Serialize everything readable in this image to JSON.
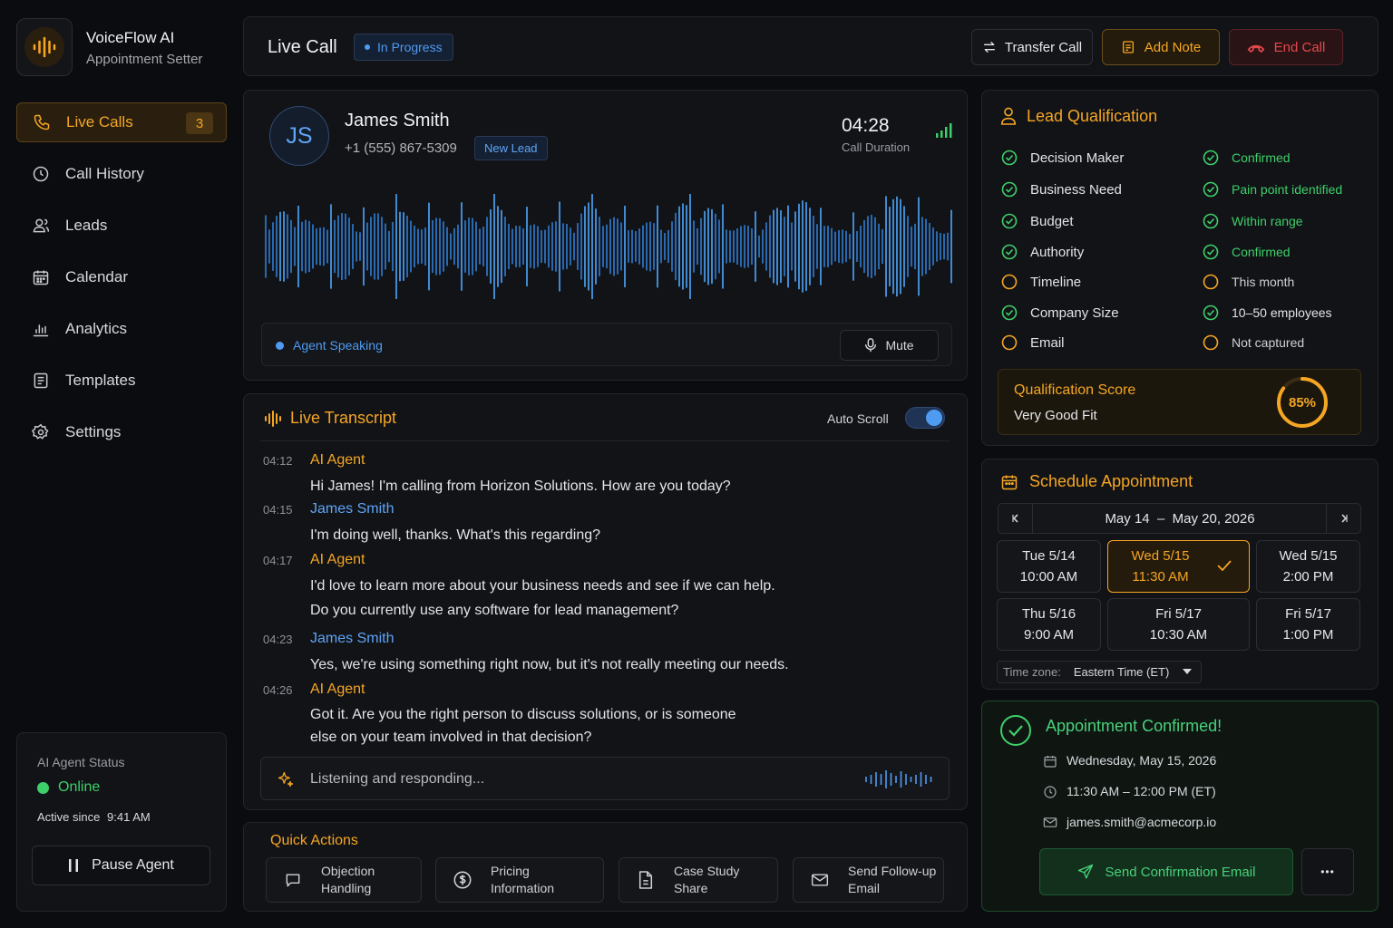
{
  "app": {
    "name": "VoiceFlow AI",
    "subtitle": "Appointment Setter"
  },
  "sidebar": {
    "items": [
      {
        "label": "Live Calls",
        "icon": "phone-icon",
        "count": "3",
        "active": true
      },
      {
        "label": "Call History",
        "icon": "clock-icon"
      },
      {
        "label": "Leads",
        "icon": "users-icon"
      },
      {
        "label": "Calendar",
        "icon": "calendar-icon"
      },
      {
        "label": "Analytics",
        "icon": "bar-chart-icon"
      },
      {
        "label": "Templates",
        "icon": "document-icon"
      },
      {
        "label": "Settings",
        "icon": "gear-icon"
      }
    ],
    "agent_status": {
      "title": "AI Agent Status",
      "status": "Online",
      "active_since_label": "Active since",
      "active_since": "9:41 AM",
      "pause_label": "Pause Agent"
    }
  },
  "header": {
    "title": "Live Call",
    "status": "In Progress",
    "transfer_label": "Transfer Call",
    "note_label": "Add Note",
    "end_label": "End Call"
  },
  "caller": {
    "initials": "JS",
    "name": "James Smith",
    "phone": "+1 (555) 867-5309",
    "tag": "New Lead",
    "duration": "04:28",
    "duration_label": "Call Duration",
    "speaking_label": "Agent Speaking",
    "mute_label": "Mute"
  },
  "transcript": {
    "title": "Live Transcript",
    "auto_scroll_label": "Auto Scroll",
    "auto_scroll_on": true,
    "entries": [
      {
        "time": "04:12",
        "speaker": "AI Agent",
        "lines": [
          "Hi James! I'm calling from Horizon Solutions. How are you today?"
        ]
      },
      {
        "time": "04:15",
        "speaker": "James Smith",
        "lines": [
          "I'm doing well, thanks. What's this regarding?"
        ]
      },
      {
        "time": "04:17",
        "speaker": "AI Agent",
        "lines": [
          "I'd love to learn more about your business needs and see if we can help.",
          "Do you currently use any software for lead management?"
        ]
      },
      {
        "time": "04:23",
        "speaker": "James Smith",
        "lines": [
          "Yes, we're using something right now, but it's not really meeting our needs."
        ]
      },
      {
        "time": "04:26",
        "speaker": "AI Agent",
        "lines": [
          "Got it. Are you the right person to discuss solutions, or is someone",
          "else on your team involved in that decision?"
        ]
      }
    ],
    "listening_label": "Listening and responding..."
  },
  "quick_actions": {
    "title": "Quick Actions",
    "items": [
      {
        "line1": "Objection",
        "line2": "Handling",
        "icon": "chat-bubble-icon"
      },
      {
        "line1": "Pricing",
        "line2": "Information",
        "icon": "dollar-icon"
      },
      {
        "line1": "Case Study",
        "line2": "Share",
        "icon": "file-icon"
      },
      {
        "line1": "Send Follow-up",
        "line2": "Email",
        "icon": "mail-icon"
      }
    ]
  },
  "qualification": {
    "title": "Lead Qualification",
    "rows": [
      {
        "label": "Decision Maker",
        "value": "Confirmed",
        "state": "done"
      },
      {
        "label": "Business Need",
        "value": "Pain point identified",
        "state": "done"
      },
      {
        "label": "Budget",
        "value": "Within range",
        "state": "done"
      },
      {
        "label": "Authority",
        "value": "Confirmed",
        "state": "done"
      },
      {
        "label": "Timeline",
        "value": "This month",
        "state": "pending"
      },
      {
        "label": "Company Size",
        "value": "10–50 employees",
        "state": "done"
      },
      {
        "label": "Email",
        "value": "Not captured",
        "state": "pending"
      }
    ],
    "score_label": "Qualification Score",
    "score_desc": "Very Good Fit",
    "score": "85%",
    "score_value": 0.85
  },
  "schedule": {
    "title": "Schedule Appointment",
    "range": "May 14  –  May 20, 2026",
    "slots": [
      {
        "day": "Tue 5/14",
        "time": "10:00 AM"
      },
      {
        "day": "Wed 5/15",
        "time": "11:30 AM",
        "selected": true
      },
      {
        "day": "Wed 5/15",
        "time": "2:00 PM"
      },
      {
        "day": "Thu 5/16",
        "time": "9:00 AM"
      },
      {
        "day": "Fri 5/17",
        "time": "10:30 AM"
      },
      {
        "day": "Fri 5/17",
        "time": "1:00 PM"
      }
    ],
    "timezone_label": "Time zone:",
    "timezone": "Eastern Time (ET)"
  },
  "confirmation": {
    "title": "Appointment Confirmed!",
    "date": "Wednesday, May 15, 2026",
    "time": "11:30 AM – 12:00 PM (ET)",
    "email": "james.smith@acmecorp.io",
    "send_label": "Send Confirmation Email",
    "more_label": "•••"
  },
  "colors": {
    "accent": "#f5a623",
    "blue": "#4f9bf2",
    "green": "#3ecf6a",
    "danger": "#e5484d",
    "background": "#0b0c0f"
  }
}
